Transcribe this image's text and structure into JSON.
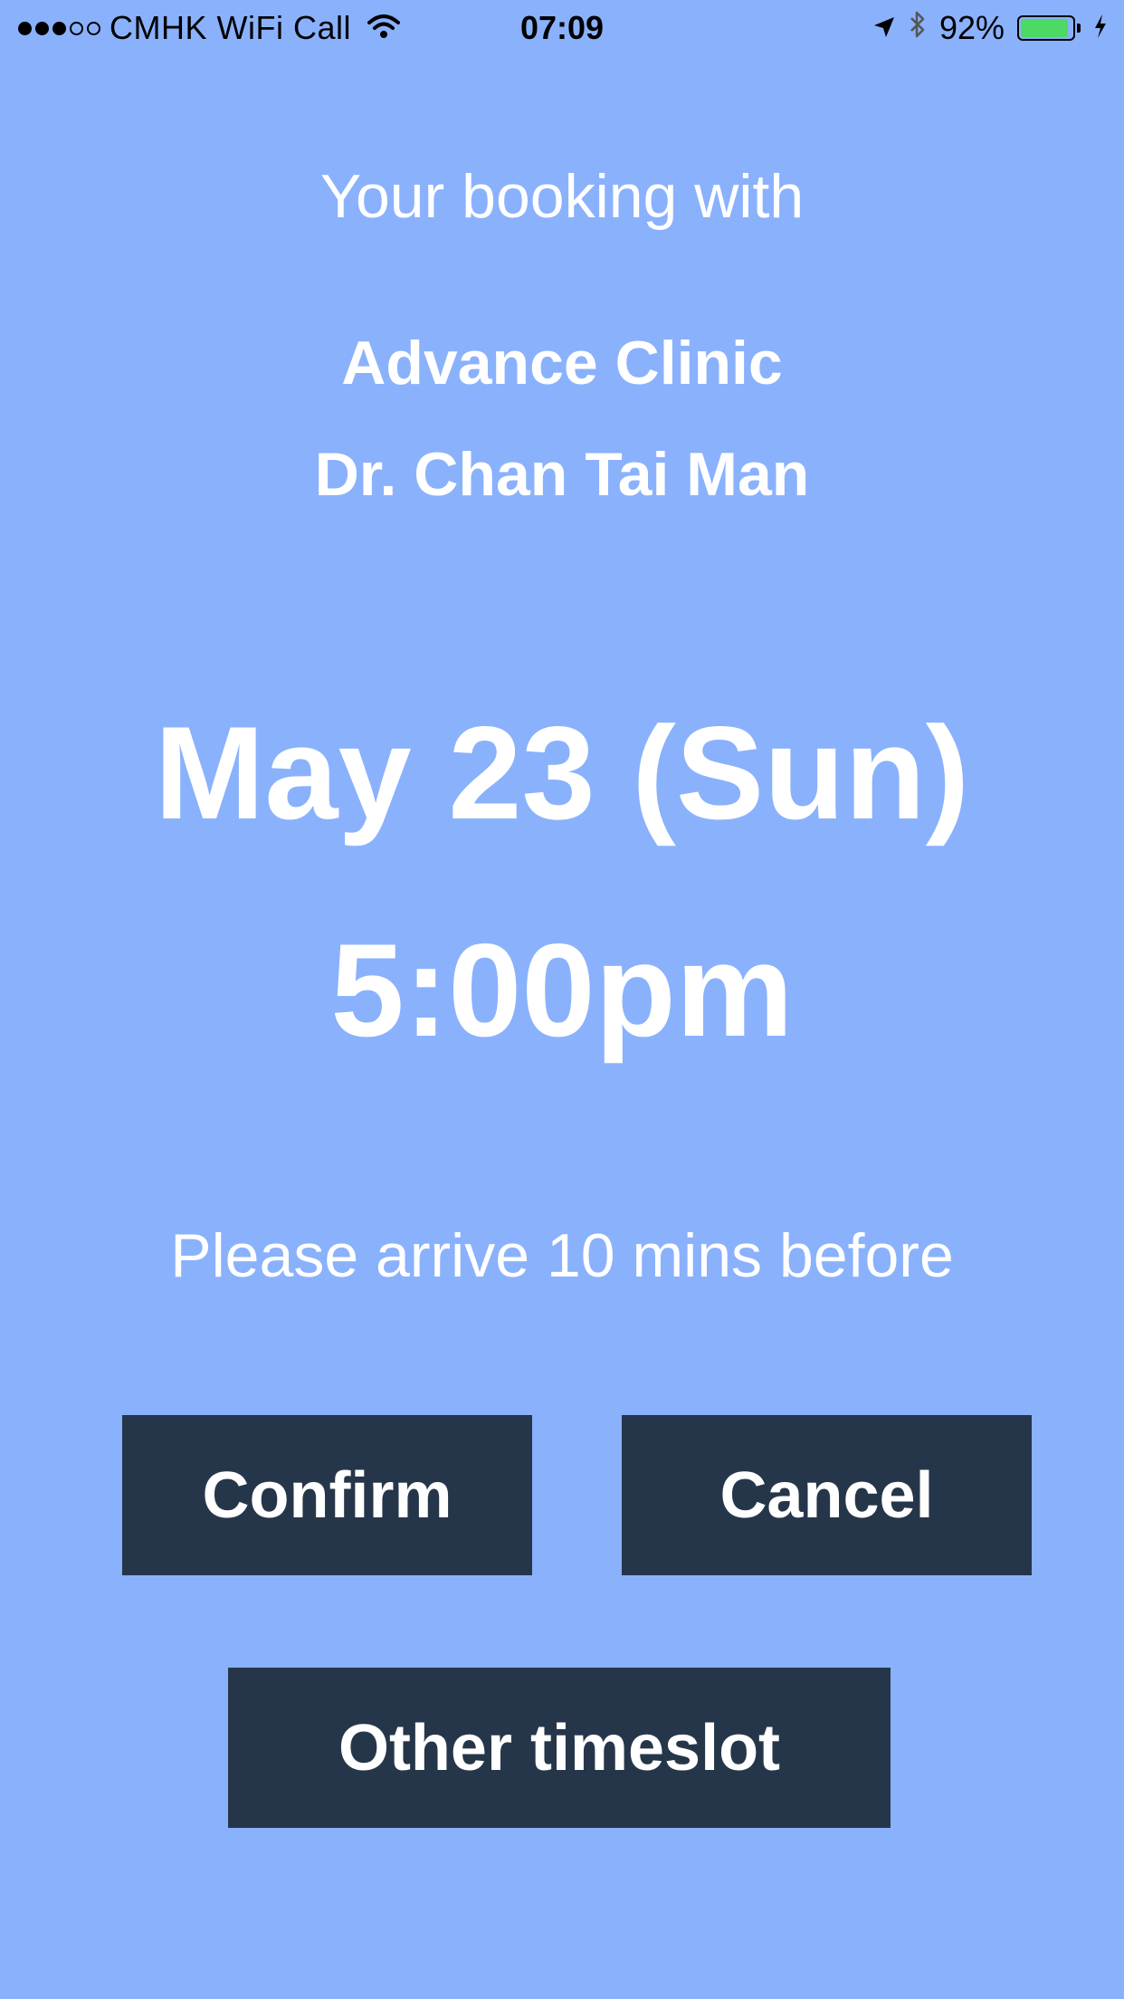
{
  "status_bar": {
    "signal_filled": 3,
    "signal_total": 5,
    "carrier": "CMHK WiFi Call",
    "time": "07:09",
    "battery_percent_label": "92%",
    "battery_level": 0.92,
    "battery_color": "#4CD964",
    "icons": [
      "wifi-icon",
      "location-arrow-icon",
      "bluetooth-icon",
      "battery-icon",
      "charging-bolt-icon"
    ]
  },
  "booking": {
    "intro": "Your booking with",
    "clinic": "Advance Clinic",
    "doctor": "Dr. Chan Tai Man",
    "date": "May 23 (Sun)",
    "time": "5:00pm",
    "note": "Please arrive 10 mins before"
  },
  "actions": {
    "confirm_label": "Confirm",
    "cancel_label": "Cancel",
    "other_label": "Other timeslot"
  },
  "colors": {
    "background": "#8AB1FC",
    "button": "#26364A",
    "text": "#FFFFFF"
  }
}
